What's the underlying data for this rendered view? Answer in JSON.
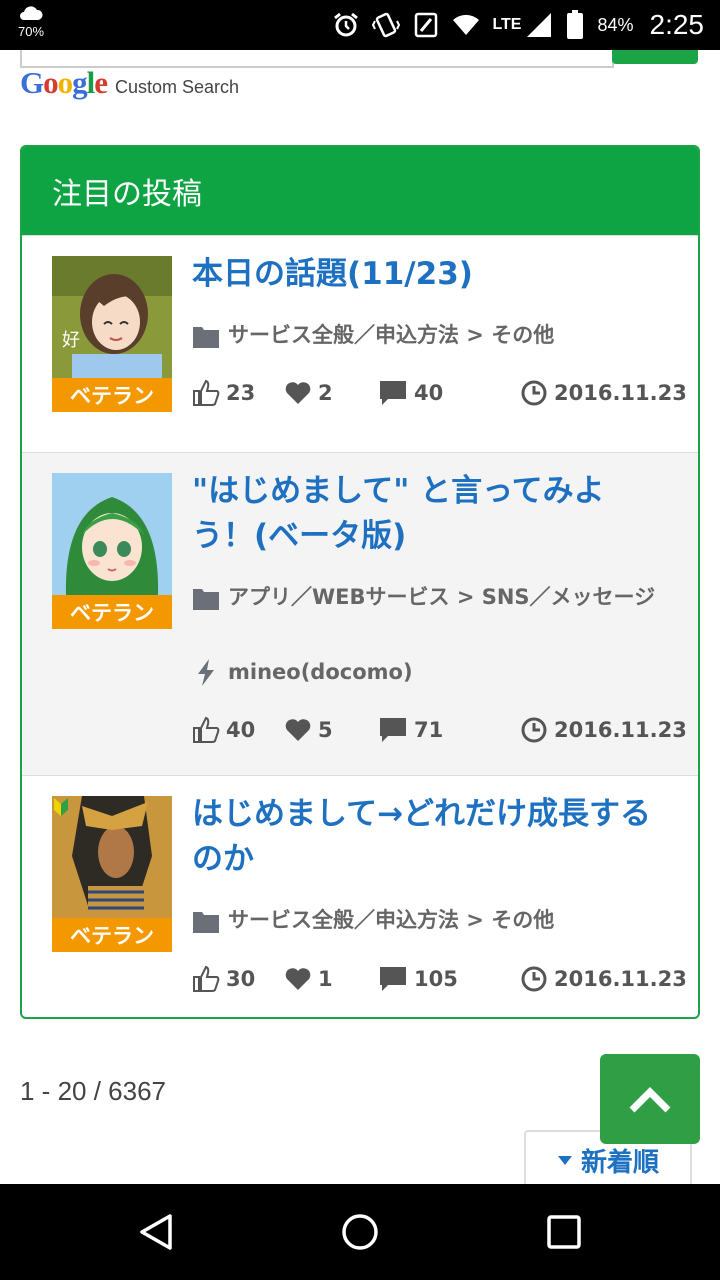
{
  "status_bar": {
    "weather_percent": "70%",
    "network": "LTE",
    "battery": "84%",
    "time": "2:25"
  },
  "search": {
    "brand_logo": "Google",
    "brand_suffix": "Custom Search"
  },
  "panel": {
    "title": "注目の投稿",
    "posts": [
      {
        "title": "本日の話題(11/23)",
        "category": "サービス全般／申込方法 > その他",
        "tag": "",
        "badge": "ベテラン",
        "likes": "23",
        "hearts": "2",
        "comments": "40",
        "date": "2016.11.23"
      },
      {
        "title": "\"はじめまして\" と言ってみよう！(ベータ版)",
        "category": "アプリ／WEBサービス > SNS／メッセージ",
        "tag": "mineo(docomo)",
        "badge": "ベテラン",
        "likes": "40",
        "hearts": "5",
        "comments": "71",
        "date": "2016.11.23"
      },
      {
        "title": "はじめまして→どれだけ成長するのか",
        "category": "サービス全般／申込方法 > その他",
        "tag": "",
        "badge": "ベテラン",
        "likes": "30",
        "hearts": "1",
        "comments": "105",
        "date": "2016.11.23"
      }
    ]
  },
  "pagination": {
    "range": "1 - 20 / 6367"
  },
  "sort": {
    "label": "新着順"
  },
  "colors": {
    "brand_green": "#0ea343",
    "link_blue": "#1e70c0",
    "badge_orange": "#f39800",
    "top_button_green": "#2f9e44"
  }
}
